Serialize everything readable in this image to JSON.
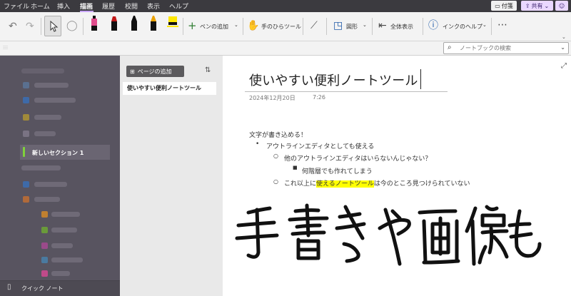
{
  "menu": {
    "tabs": [
      "ファイル",
      "ホーム",
      "挿入",
      "描画",
      "履歴",
      "校閲",
      "表示",
      "ヘルプ"
    ],
    "active_tab": "描画",
    "notes_label": "付箋",
    "share_label": "共有"
  },
  "ribbon": {
    "add_pen_label": "ペンの追加",
    "hand_tool_label": "手のひらツール",
    "shapes_label": "図形",
    "full_view_label": "全体表示",
    "ink_help_label": "インクのヘルプ",
    "pen_colors": [
      "#e04c8c",
      "#c01818",
      "#101010",
      "#e8a000",
      "#ffe800"
    ]
  },
  "search": {
    "placeholder": "ノートブックの検索"
  },
  "sidebar": {
    "active_section": "新しいセクション 1",
    "quick_note_label": "クイック ノート"
  },
  "pagelist": {
    "add_page_label": "ページの追加",
    "pages": [
      "使いやすい便利ノートツール"
    ]
  },
  "page": {
    "title": "使いやすい便利ノートツール",
    "date": "2024年12月20日",
    "time": "7:26",
    "lines": {
      "intro": "文字が書き込める！",
      "bullet1": "アウトラインエディタとしても使える",
      "sub1": "他のアウトラインエディタはいらないんじゃない？",
      "subsub1": "何階層でも作れてしまう",
      "sub2_before": "これ以上に",
      "sub2_highlight": "使えるノートツール",
      "sub2_after": "は今のところ見つけられていない"
    },
    "handwriting": "手書きや画像も"
  }
}
